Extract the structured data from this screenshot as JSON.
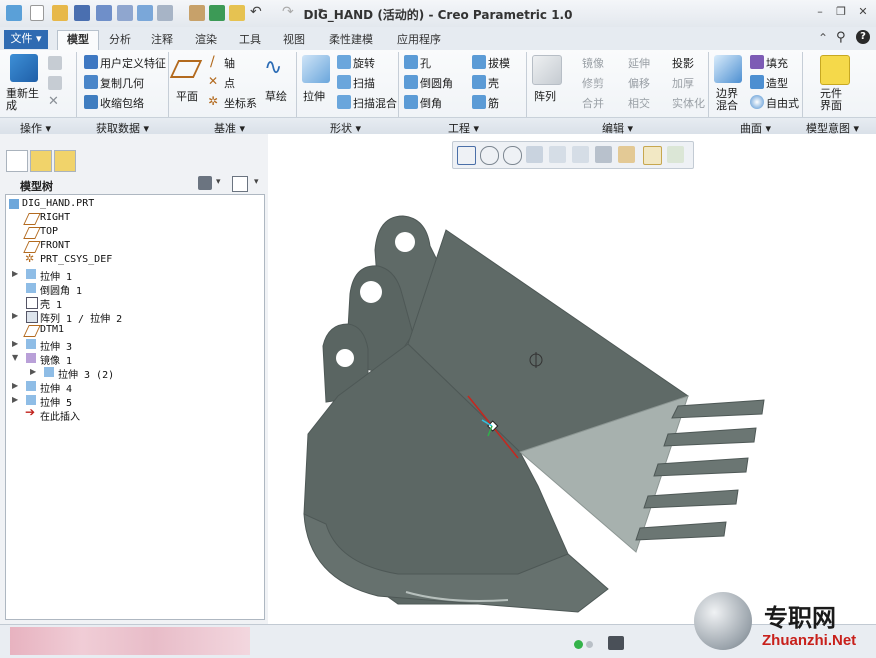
{
  "window": {
    "title": "DIG_HAND (活动的) - Creo Parametric 1.0"
  },
  "tabs": [
    {
      "label": "文件 ▾"
    },
    {
      "label": "模型"
    },
    {
      "label": "分析"
    },
    {
      "label": "注释"
    },
    {
      "label": "渲染"
    },
    {
      "label": "工具"
    },
    {
      "label": "视图"
    },
    {
      "label": "柔性建模"
    },
    {
      "label": "应用程序"
    }
  ],
  "ribbon": {
    "regen": "重新生成",
    "user_feature": "用户定义特征",
    "copy_geom": "复制几何",
    "shrinkwrap": "收缩包络",
    "plane": "平面",
    "axis": "轴",
    "point": "点",
    "csys": "坐标系",
    "sketch": "草绘",
    "extrude": "拉伸",
    "revolve": "旋转",
    "sweep": "扫描",
    "swept_blend": "扫描混合",
    "hole": "孔",
    "round": "倒圆角",
    "chamfer": "倒角",
    "draft": "拔模",
    "shell": "壳",
    "rib": "筋",
    "pattern": "阵列",
    "mirror": "镜像",
    "trim": "修剪",
    "merge": "合并",
    "extend": "延伸",
    "offset": "偏移",
    "intersect": "相交",
    "project": "投影",
    "thicken": "加厚",
    "solidify": "实体化",
    "boundary": "边界混合",
    "fill": "填充",
    "style": "造型",
    "freestyle": "自由式",
    "component_interface": "元件界面"
  },
  "groups": [
    "操作 ▾",
    "获取数据 ▾",
    "基准 ▾",
    "形状 ▾",
    "工程 ▾",
    "编辑 ▾",
    "曲面 ▾",
    "模型意图 ▾"
  ],
  "panel": {
    "header": "模型树"
  },
  "tree": [
    {
      "label": "DIG_HAND.PRT"
    },
    {
      "label": "RIGHT"
    },
    {
      "label": "TOP"
    },
    {
      "label": "FRONT"
    },
    {
      "label": "PRT_CSYS_DEF"
    },
    {
      "label": "拉伸 1"
    },
    {
      "label": "倒圆角 1"
    },
    {
      "label": "壳 1"
    },
    {
      "label": "阵列 1 / 拉伸 2"
    },
    {
      "label": "DTM1"
    },
    {
      "label": "拉伸 3"
    },
    {
      "label": "镜像 1"
    },
    {
      "label": "拉伸 3 (2)"
    },
    {
      "label": "拉伸 4"
    },
    {
      "label": "拉伸 5"
    },
    {
      "label": "在此插入"
    }
  ],
  "watermark": {
    "cn": "专职网",
    "en": "Zhuanzhi.Net"
  },
  "colors": {
    "accent": "#2f6bb2",
    "model": "#5f6a67",
    "model_light": "#a7b1ae"
  }
}
